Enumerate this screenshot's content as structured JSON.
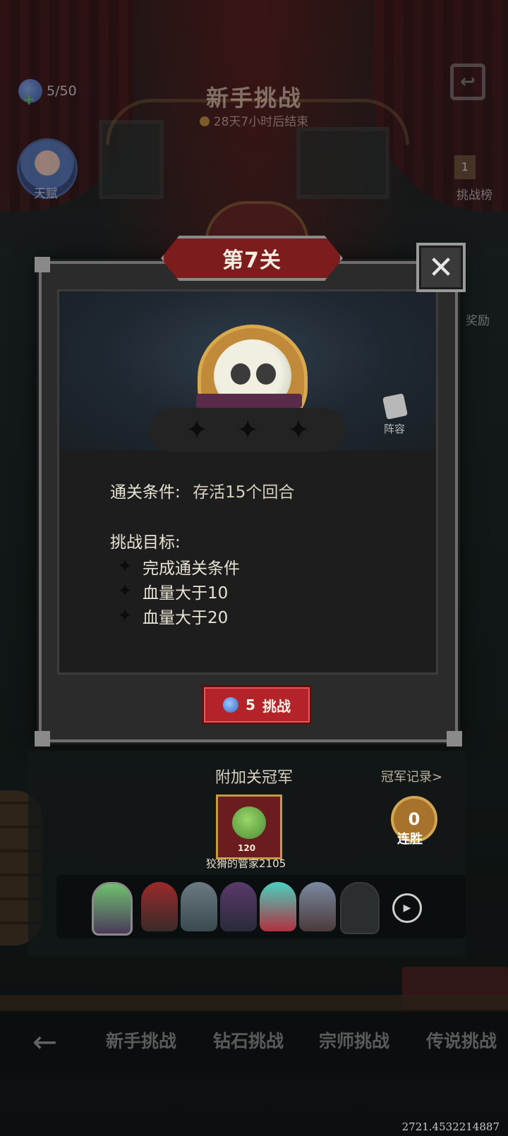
{
  "header": {
    "stamina": "5/50",
    "title": "新手挑战",
    "countdown": "28天7小时后结束",
    "talent_label": "天赋",
    "rank_badge": "1",
    "leaderboard_label": "挑战榜",
    "reward_label": "奖励"
  },
  "modal": {
    "stage_title": "第7关",
    "close_symbol": "✕",
    "lineup_label": "阵容",
    "stars": [
      "✦",
      "✦",
      "✦"
    ],
    "condition_label": "通关条件:",
    "condition_value": "存活15个回合",
    "goals_heading": "挑战目标:",
    "goals": [
      "完成通关条件",
      "血量大于10",
      "血量大于20"
    ],
    "challenge_cost": "5",
    "challenge_label": "挑战",
    "star_icon": "✦"
  },
  "champion": {
    "title": "附加关冠军",
    "record_link": "冠军记录>",
    "name": "狡猾的管家2105",
    "level": "120",
    "streak_count": "0",
    "streak_label": "连胜",
    "play_symbol": "▶"
  },
  "tabs": [
    "新手挑战",
    "钻石挑战",
    "宗师挑战",
    "传说挑战"
  ],
  "back_symbol": "←",
  "coordinate_readout": "2721.4532214887",
  "colors": {
    "accent_red": "#b4232a",
    "panel_gray": "#2b2b2b",
    "gold": "#c49a45"
  }
}
